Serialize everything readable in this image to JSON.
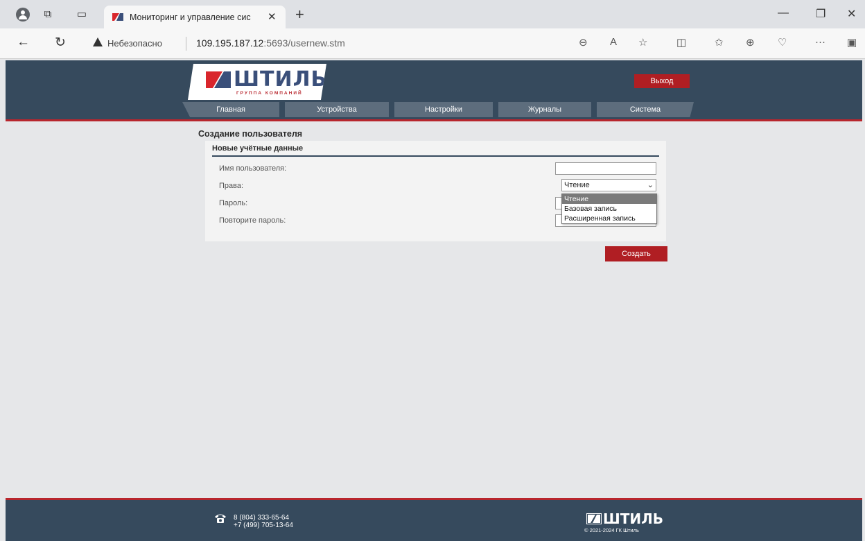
{
  "browser": {
    "tab_title": "Мониторинг и управление сис",
    "security_label": "Небезопасно",
    "url_host": "109.195.187.12",
    "url_rest": ":5693/usernew.stm"
  },
  "site": {
    "logo_text": "ШТИЛЬ",
    "logo_sub": "ГРУППА КОМПАНИЙ",
    "logout_label": "Выход",
    "menu": [
      {
        "label": "Главная"
      },
      {
        "label": "Устройства"
      },
      {
        "label": "Настройки"
      },
      {
        "label": "Журналы"
      },
      {
        "label": "Система"
      }
    ]
  },
  "form": {
    "page_title": "Создание пользователя",
    "section_title": "Новые учётные данные",
    "username_label": "Имя пользователя:",
    "username_value": "",
    "rights_label": "Права:",
    "rights_selected": "Чтение",
    "rights_options": [
      "Чтение",
      "Базовая запись",
      "Расширенная запись"
    ],
    "password_label": "Пароль:",
    "password_repeat_label": "Повторите пароль:",
    "create_label": "Создать"
  },
  "footer": {
    "phone1": "8 (804) 333-65-64",
    "phone2": "+7 (499) 705-13-64",
    "logo_text": "ШТИЛЬ",
    "copyright": "© 2021-2024 ГК Штиль"
  },
  "colors": {
    "header_bg": "#364a5d",
    "accent_red": "#b01e23",
    "logo_blue": "#3a4f7a"
  }
}
